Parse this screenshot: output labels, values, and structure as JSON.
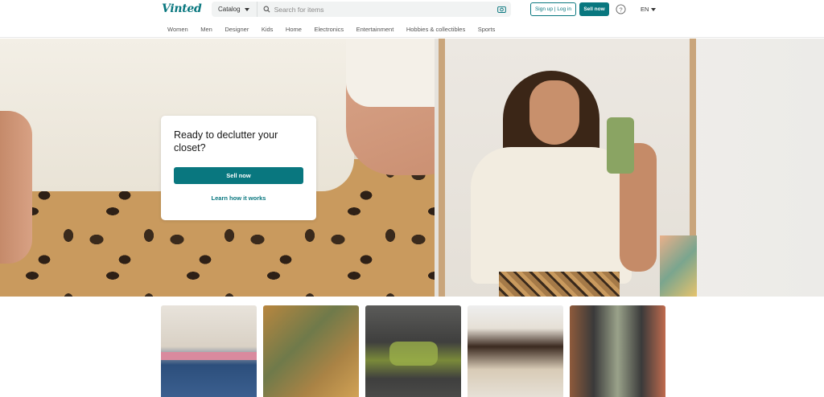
{
  "header": {
    "logo": "Vinted",
    "catalog_label": "Catalog",
    "search_placeholder": "Search for items",
    "signup_label": "Sign up | Log in",
    "sell_label": "Sell now",
    "language": "EN"
  },
  "categories": [
    "Women",
    "Men",
    "Designer",
    "Kids",
    "Home",
    "Electronics",
    "Entertainment",
    "Hobbies & collectibles",
    "Sports"
  ],
  "hero": {
    "title": "Ready to declutter your closet?",
    "sell_button": "Sell now",
    "learn_link": "Learn how it works"
  },
  "colors": {
    "brand": "#09777f",
    "text": "#171717"
  },
  "icons": {
    "search": "search-icon",
    "camera": "camera-icon",
    "help": "help-icon"
  }
}
